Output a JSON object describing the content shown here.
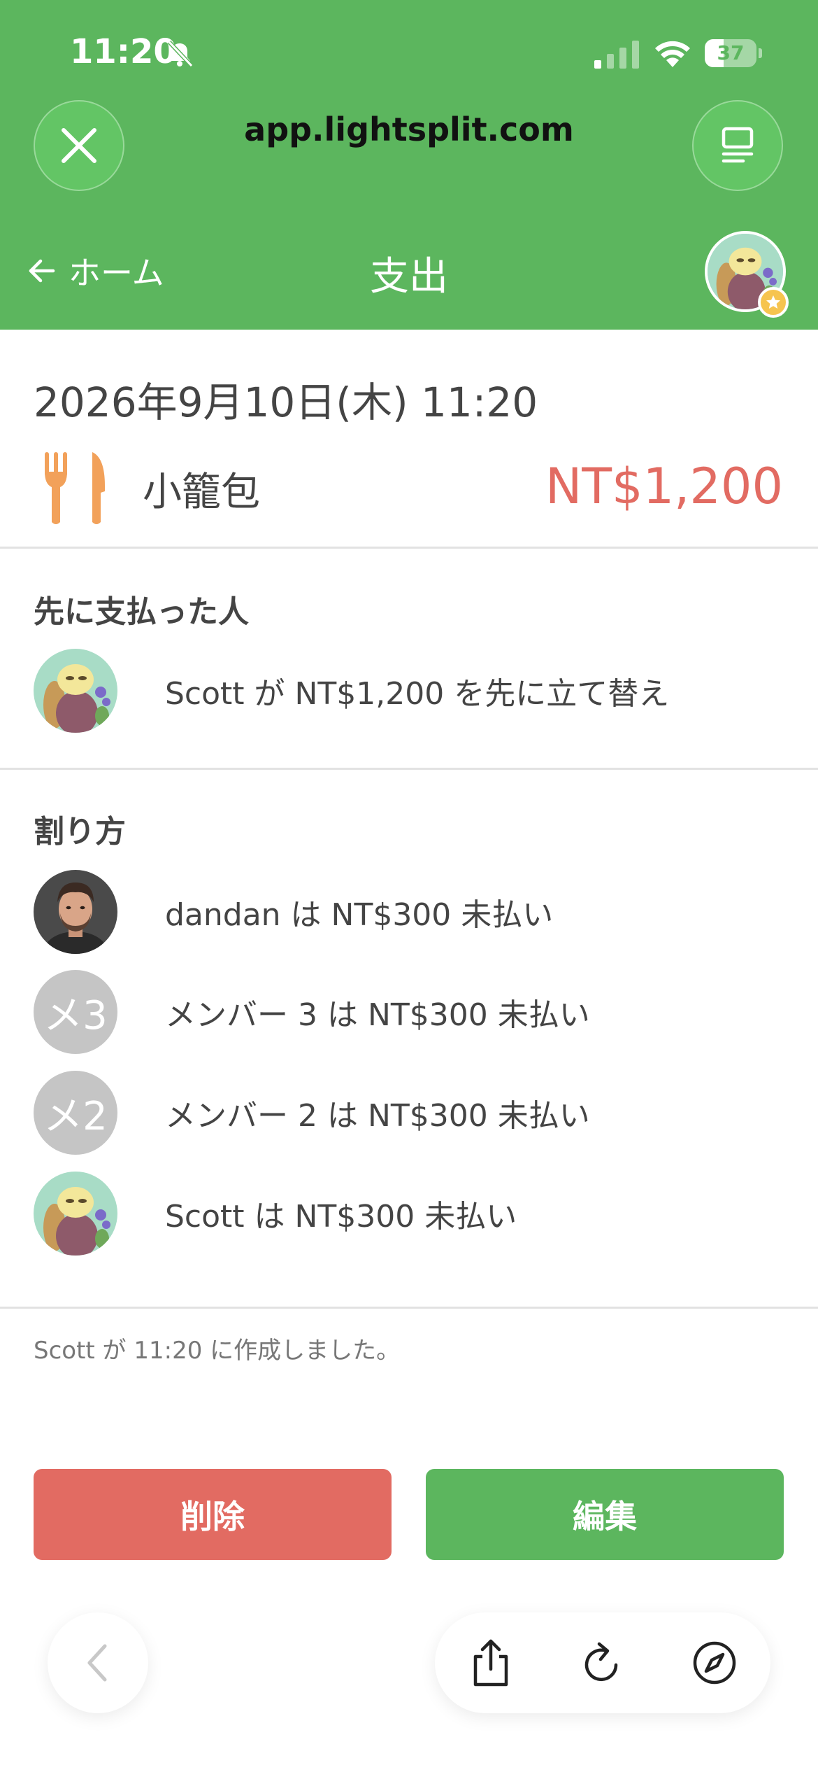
{
  "status_bar": {
    "time": "11:20",
    "battery_level": "37",
    "battery_fraction": 0.37
  },
  "browser": {
    "url": "app.lightsplit.com",
    "close_icon": "close-icon",
    "tabs_icon": "tabs-icon"
  },
  "nav": {
    "back_label": "ホーム",
    "title": "支出"
  },
  "expense": {
    "datetime": "2026年9月10日(木) 11:20",
    "category_icon": "fork-knife-icon",
    "name": "小籠包",
    "amount": "NT$1,200"
  },
  "payer_section": {
    "title": "先に支払った人",
    "payers": [
      {
        "text": "Scott が NT$1,200 を先に立て替え",
        "avatar": "character"
      }
    ]
  },
  "split_section": {
    "title": "割り方",
    "members": [
      {
        "text": "dandan は NT$300 未払い",
        "avatar": "photo"
      },
      {
        "text": "メンバー 3 は NT$300 未払い",
        "avatar_initials": "メ3"
      },
      {
        "text": "メンバー 2 は NT$300 未払い",
        "avatar_initials": "メ2"
      },
      {
        "text": "Scott は NT$300 未払い",
        "avatar": "character"
      }
    ]
  },
  "footer": {
    "created": "Scott が 11:20 に作成しました。"
  },
  "actions": {
    "delete_label": "削除",
    "edit_label": "編集"
  },
  "colors": {
    "brand_green": "#5cb65e",
    "amount_red": "#e26b62"
  }
}
